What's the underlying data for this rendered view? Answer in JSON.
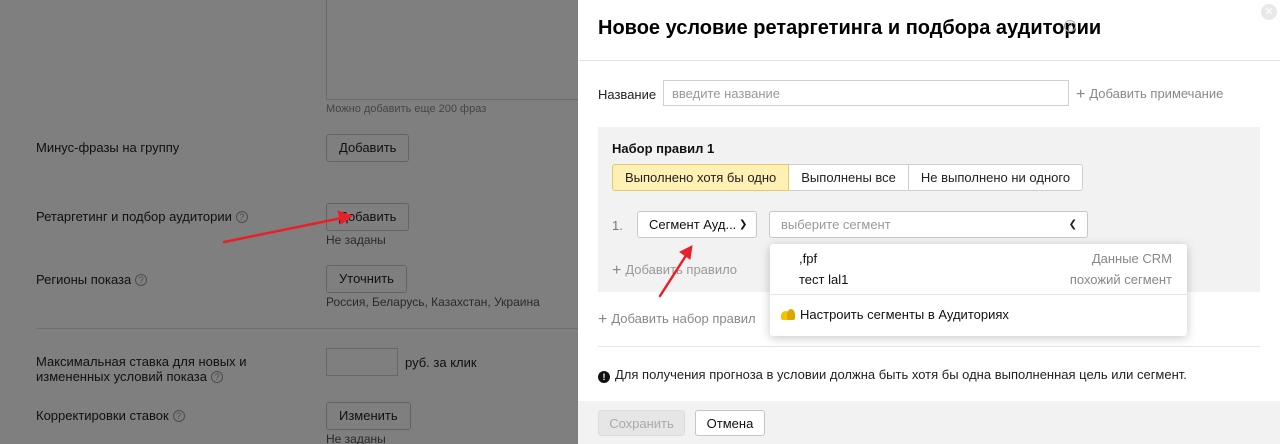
{
  "background": {
    "phrases_hint": "Можно добавить еще 200 фраз",
    "rows": {
      "minus_phrases": {
        "label": "Минус-фразы на группу",
        "button": "Добавить"
      },
      "retargeting": {
        "label": "Ретаргетинг и подбор аудитории",
        "button": "Добавить",
        "status": "Не заданы"
      },
      "regions": {
        "label": "Регионы показа",
        "button": "Уточнить",
        "status": "Россия, Беларусь, Казахстан, Украина"
      },
      "max_bid": {
        "label_line1": "Максимальная ставка для новых и",
        "label_line2": "измененных условий показа",
        "unit": "руб. за клик"
      },
      "bid_adjustments": {
        "label": "Корректировки ставок",
        "button": "Изменить",
        "status": "Не заданы"
      }
    },
    "help_icon": "?"
  },
  "modal": {
    "title": "Новое условие ретаргетинга и подбора аудитории",
    "help_icon": "?",
    "close_icon": "close-icon",
    "name": {
      "label": "Название",
      "value": "",
      "placeholder": "введите название"
    },
    "add_note": "Добавить примечание",
    "ruleset": {
      "title": "Набор правил  1",
      "modes": [
        {
          "label": "Выполнено хотя бы одно",
          "active": true
        },
        {
          "label": "Выполнены все",
          "active": false
        },
        {
          "label": "Не выполнено ни одного",
          "active": false
        }
      ],
      "rule": {
        "number": "1.",
        "type_selected": "Сегмент Ауд...",
        "segment_placeholder": "выберите сегмент"
      },
      "add_rule": "Добавить правило"
    },
    "add_ruleset": "Добавить набор правил",
    "info": "Для получения прогноза в условии должна быть хотя бы одна выполненная цель или сегмент.",
    "buttons": {
      "save": "Сохранить",
      "cancel": "Отмена"
    }
  },
  "dropdown": {
    "items": [
      {
        "name": ",fpf",
        "type": "Данные CRM"
      },
      {
        "name": "тест lal1",
        "type": "похожий сегмент"
      }
    ],
    "configure": "Настроить сегменты в Аудиториях"
  },
  "colors": {
    "active_mode": "#fff0b3",
    "annotation_arrow": "#e8202a",
    "audience_icon": "#f5c400"
  }
}
